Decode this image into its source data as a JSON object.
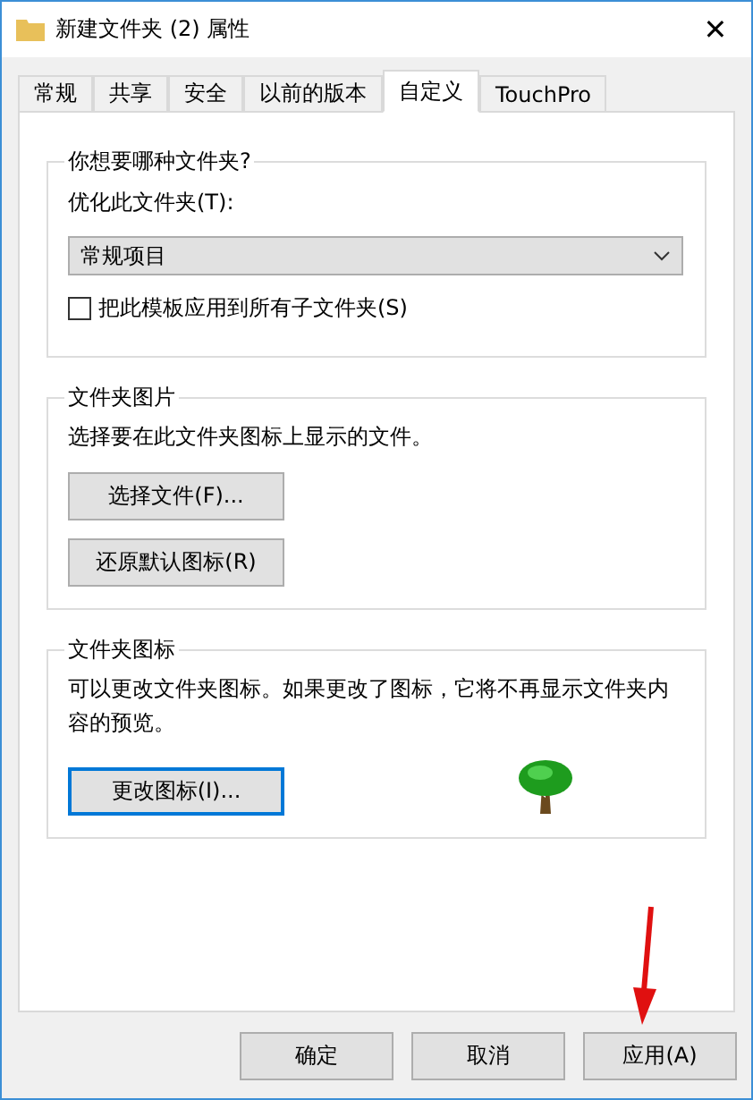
{
  "window": {
    "title": "新建文件夹 (2) 属性",
    "close": "✕"
  },
  "tabs": [
    {
      "label": "常规",
      "selected": false
    },
    {
      "label": "共享",
      "selected": false
    },
    {
      "label": "安全",
      "selected": false
    },
    {
      "label": "以前的版本",
      "selected": false
    },
    {
      "label": "自定义",
      "selected": true
    },
    {
      "label": "TouchPro",
      "selected": false
    }
  ],
  "groups": [
    {
      "title": "你想要哪种文件夹?",
      "kind": "template",
      "label": "优化此文件夹(T):",
      "select": {
        "value": "常规项目"
      },
      "checkbox": {
        "label": "把此模板应用到所有子文件夹(S)",
        "checked": false
      }
    },
    {
      "title": "文件夹图片",
      "kind": "picture",
      "text": "选择要在此文件夹图标上显示的文件。",
      "buttons": [
        {
          "label": "选择文件(F)...",
          "focused": false
        },
        {
          "label": "还原默认图标(R)",
          "focused": false
        }
      ]
    },
    {
      "title": "文件夹图标",
      "kind": "icon",
      "text": "可以更改文件夹图标。如果更改了图标，它将不再显示文件夹内容的预览。",
      "buttons": [
        {
          "label": "更改图标(I)...",
          "focused": true
        }
      ]
    }
  ],
  "buttons": [
    "确定",
    "取消",
    "应用(A)"
  ],
  "annotation": {
    "kind": "arrow",
    "color": "#e01010"
  }
}
